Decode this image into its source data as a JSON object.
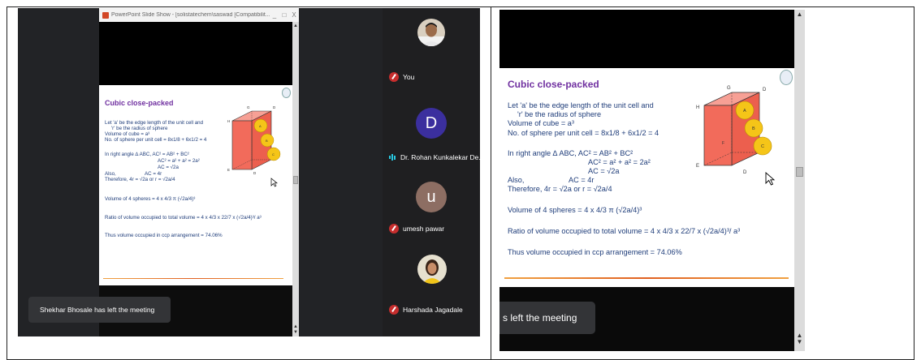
{
  "ppt_window": {
    "title": "PowerPoint Slide Show - [solistatechem\\saswad [Compatibilit...",
    "controls": [
      "_",
      "□",
      "X"
    ]
  },
  "slide": {
    "title": "Cubic close-packed",
    "lines": [
      "Let 'a' be the edge length of the unit cell and",
      "'r' be the radius of sphere",
      "Volume of cube = a³",
      "No. of sphere per unit cell = 8x1/8 + 6x1/2 = 4",
      "In right angle ∆ ABC,   AC² = AB² + BC²",
      "AC² = a² + a² = 2a²",
      "AC = √2a",
      "Also,",
      "AC = 4r",
      "Therefore,    4r = √2a   or   r = √2a/4",
      "Volume of 4 spheres = 4 x 4/3 π (√2a/4)³",
      "Ratio of volume occupied to total volume = 4 x 4/3 x 22/7 x (√2a/4)³/ a³",
      "Thus volume occupied in ccp arrangement = 74.06%"
    ],
    "cube_labels": {
      "G": "G",
      "H": "H",
      "D": "D",
      "F": "F",
      "E": "E",
      "A": "A",
      "B": "B",
      "C": "C"
    },
    "scrollbar_arrows": [
      "▲",
      "▼"
    ]
  },
  "participants": [
    {
      "name": "You",
      "avatar": "photo",
      "status": "muted"
    },
    {
      "name": "Dr. Rohan Kunkalekar De...",
      "avatar": "D",
      "avatar_color": "#3b2f9e",
      "status": "speaking"
    },
    {
      "name": "umesh pawar",
      "avatar": "u",
      "avatar_color": "#8d6e63",
      "status": "muted"
    },
    {
      "name": "Harshada Jagadale",
      "avatar": "photo",
      "status": "muted"
    }
  ],
  "left_toast": "Shekhar Bhosale has left the meeting",
  "right_toast": "s left the meeting",
  "colors": {
    "slide_title": "#7030a0",
    "slide_text": "#1f3d7a",
    "cube_face": "#f26b5b",
    "sphere": "#f5c518",
    "mute_red": "#c62d2d",
    "speaking": "#28c8e0"
  }
}
